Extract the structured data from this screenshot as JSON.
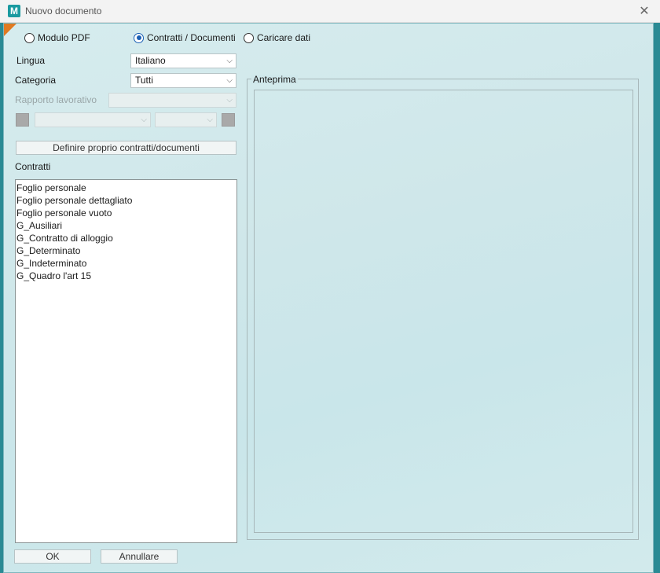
{
  "window": {
    "logo": "M",
    "title": "Nuovo documento",
    "close_glyph": "✕"
  },
  "mode_options": [
    {
      "label": "Modulo PDF",
      "selected": false
    },
    {
      "label": "Contratti / Documenti",
      "selected": true
    },
    {
      "label": "Caricare dati",
      "selected": false
    }
  ],
  "lingua": {
    "label": "Lingua",
    "value": "Italiano"
  },
  "categoria": {
    "label": "Categoria",
    "value": "Tutti"
  },
  "rapporto": {
    "label": "Rapporto lavorativo",
    "value": ""
  },
  "define_button": "Definire proprio contratti/documenti",
  "contratti": {
    "label": "Contratti",
    "items": [
      "Foglio personale",
      "Foglio personale dettagliato",
      "Foglio personale vuoto",
      "G_Ausiliari",
      "G_Contratto di alloggio",
      "G_Determinato",
      "G_Indeterminato",
      "G_Quadro l'art 15"
    ]
  },
  "preview": {
    "label": "Anteprima"
  },
  "footer": {
    "ok": "OK",
    "cancel": "Annullare"
  },
  "icons": {
    "dropdown": "chevron-down-icon",
    "close": "close-icon"
  },
  "colors": {
    "accent": "#1b5fb4",
    "corner": "#e07a22",
    "logo": "#1a9aa0"
  }
}
